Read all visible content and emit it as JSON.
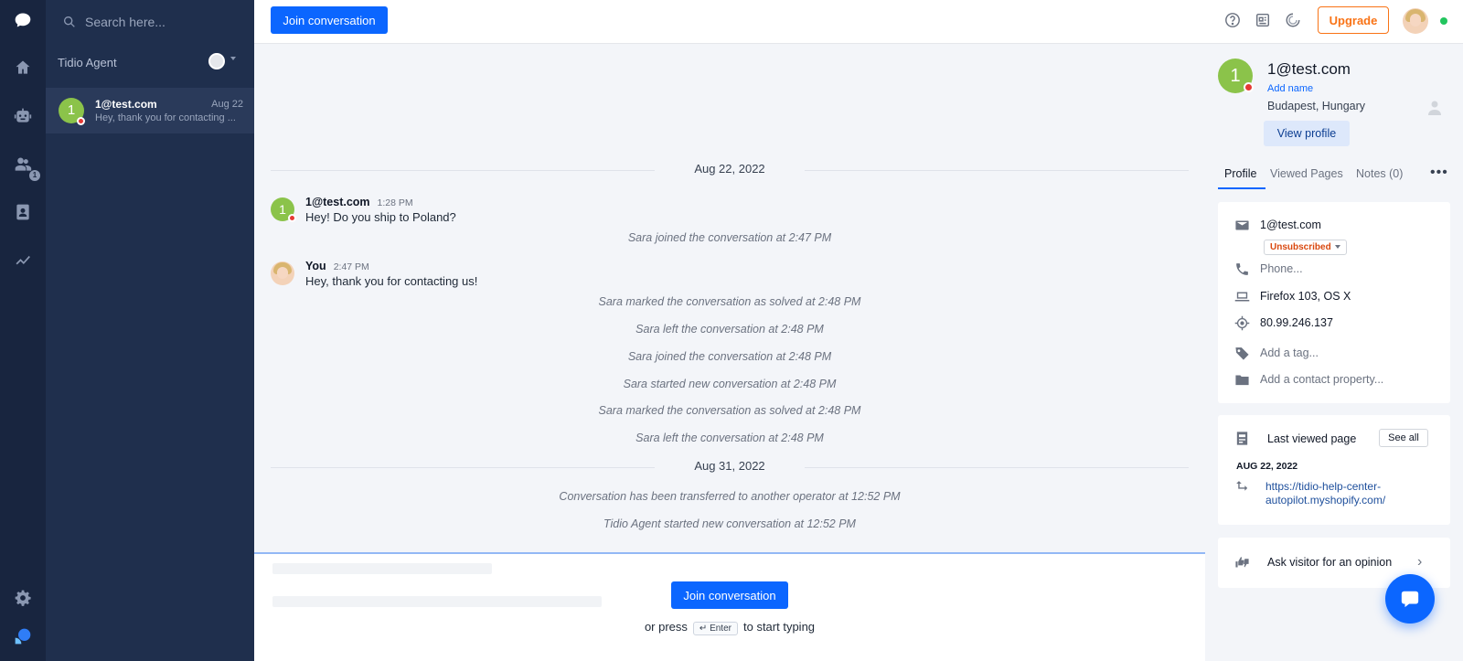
{
  "sidebar": {
    "people_badge": "1"
  },
  "conversation_list": {
    "search_placeholder": "Search here...",
    "agent_name": "Tidio Agent",
    "items": [
      {
        "avatar_letter": "1",
        "email": "1@test.com",
        "date": "Aug 22",
        "preview": "Hey, thank you for contacting ..."
      }
    ]
  },
  "topbar": {
    "join_label": "Join conversation",
    "upgrade_label": "Upgrade"
  },
  "chat": {
    "date1": "Aug 22, 2022",
    "msg1": {
      "avatar_letter": "1",
      "name": "1@test.com",
      "time": "1:28 PM",
      "text": "Hey! Do you ship to Poland?"
    },
    "sys1": "Sara joined the conversation at 2:47 PM",
    "msg2": {
      "name": "You",
      "time": "2:47 PM",
      "text": "Hey, thank you for contacting us!"
    },
    "sys2": "Sara marked the conversation as solved at 2:48 PM",
    "sys3": "Sara left the conversation at 2:48 PM",
    "sys4": "Sara joined the conversation at 2:48 PM",
    "sys5": "Sara started new conversation at 2:48 PM",
    "sys6": "Sara marked the conversation as solved at 2:48 PM",
    "sys7": "Sara left the conversation at 2:48 PM",
    "date2": "Aug 31, 2022",
    "sys8": "Conversation has been transferred to another operator at 12:52 PM",
    "sys9": "Tidio Agent started new conversation at 12:52 PM"
  },
  "composer": {
    "join_label": "Join conversation",
    "press_prefix": "or press",
    "key_label": "↵ Enter",
    "press_suffix": "to start typing"
  },
  "contact": {
    "avatar_letter": "1",
    "email": "1@test.com",
    "add_name": "Add name",
    "location": "Budapest, Hungary",
    "view_profile": "View profile",
    "tabs": [
      "Profile",
      "Viewed Pages",
      "Notes (0)"
    ],
    "details": {
      "email": "1@test.com",
      "subscription": "Unsubscribed",
      "phone": "Phone...",
      "browser": "Firefox 103, OS X",
      "ip": "80.99.246.137",
      "tag": "Add a tag...",
      "property": "Add a contact property..."
    },
    "last_viewed": {
      "title": "Last viewed page",
      "see_all": "See all",
      "date": "AUG 22, 2022",
      "url": "https://tidio-help-center-autopilot.myshopify.com/"
    },
    "opinion": "Ask visitor for an opinion"
  }
}
